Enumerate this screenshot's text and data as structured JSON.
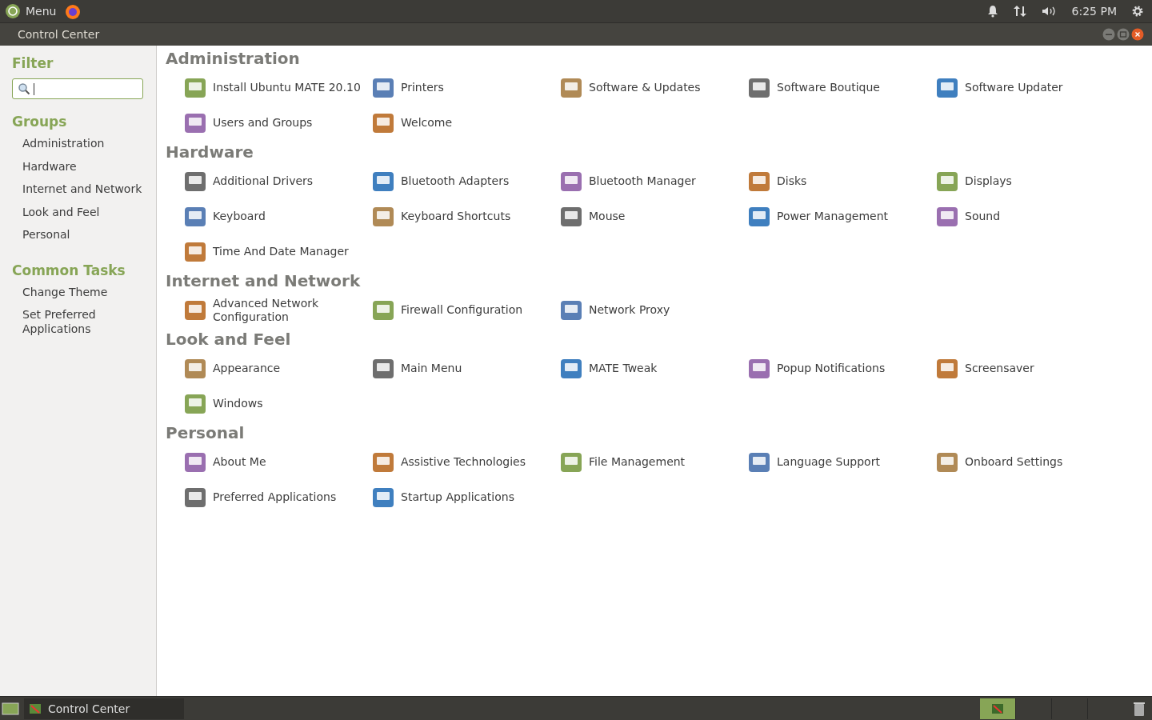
{
  "top_panel": {
    "menu": "Menu",
    "clock": "6:25 PM"
  },
  "window": {
    "title": "Control Center"
  },
  "sidebar": {
    "filter_heading": "Filter",
    "groups_heading": "Groups",
    "groups": [
      {
        "label": "Administration"
      },
      {
        "label": "Hardware"
      },
      {
        "label": "Internet and Network"
      },
      {
        "label": "Look and Feel"
      },
      {
        "label": "Personal"
      }
    ],
    "tasks_heading": "Common Tasks",
    "tasks": [
      {
        "label": "Change Theme"
      },
      {
        "label": "Set Preferred Applications"
      }
    ]
  },
  "sections": [
    {
      "title": "Administration",
      "items": [
        "Install Ubuntu MATE 20.10",
        "Printers",
        "Software & Updates",
        "Software Boutique",
        "Software Updater",
        "Users and Groups",
        "Welcome"
      ]
    },
    {
      "title": "Hardware",
      "items": [
        "Additional Drivers",
        "Bluetooth Adapters",
        "Bluetooth Manager",
        "Disks",
        "Displays",
        "Keyboard",
        "Keyboard Shortcuts",
        "Mouse",
        "Power Management",
        "Sound",
        "Time And Date Manager"
      ]
    },
    {
      "title": "Internet and Network",
      "items": [
        "Advanced Network Configuration",
        "Firewall Configuration",
        "Network Proxy"
      ]
    },
    {
      "title": "Look and Feel",
      "items": [
        "Appearance",
        "Main Menu",
        "MATE Tweak",
        "Popup Notifications",
        "Screensaver",
        "Windows"
      ]
    },
    {
      "title": "Personal",
      "items": [
        "About Me",
        "Assistive Technologies",
        "File Management",
        "Language Support",
        "Onboard Settings",
        "Preferred Applications",
        "Startup Applications"
      ]
    }
  ],
  "taskbar": {
    "tasks": [
      {
        "label": "Control Center",
        "selected": false
      }
    ]
  }
}
